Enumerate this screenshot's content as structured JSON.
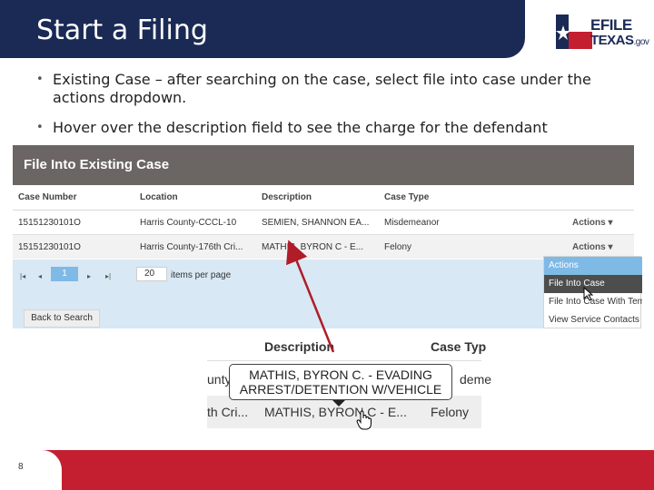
{
  "slide": {
    "title": "Start a Filing",
    "page_number": "8",
    "colors": {
      "header": "#1a2a55",
      "footer": "#c41f30",
      "arrow": "#b01c28"
    }
  },
  "logo": {
    "line1": "EFILE",
    "line2": "TEXAS",
    "suffix": ".gov",
    "icon": "texas-star-icon"
  },
  "bullets": [
    "Existing Case – after searching on the case, select file into case under the actions dropdown.",
    "Hover over the description field to see the charge for the defendant"
  ],
  "panel": {
    "title": "File Into Existing Case",
    "columns": [
      "Case Number",
      "Location",
      "Description",
      "Case Type"
    ],
    "rows": [
      {
        "case_number": "15151230101O",
        "location": "Harris County-CCCL-10",
        "description": "SEMIEN, SHANNON EA...",
        "case_type": "Misdemeanor",
        "actions": "Actions ▾"
      },
      {
        "case_number": "15151230101O",
        "location": "Harris County-176th Cri...",
        "description": "MATHIS, BYRON C - E...",
        "case_type": "Felony",
        "actions": "Actions ▾"
      }
    ],
    "pager": {
      "first": "|◂",
      "prev": "◂",
      "current": "1",
      "next": "▸",
      "last": "▸|",
      "per_page": "20",
      "per_page_label": "items per page"
    },
    "back_button": "Back to Search",
    "menu": [
      "Actions",
      "File Into Case",
      "File Into Case With Tem",
      "View Service Contacts"
    ]
  },
  "zoom": {
    "col_desc": "Description",
    "col_type": "Case Typ",
    "row1_left": "unty.",
    "row1_right": "deme",
    "row2_left": "th Cri...",
    "row2_desc": "MATHIS, BYRON C - E...",
    "row2_type": "Felony",
    "tooltip_line1": "MATHIS, BYRON C. - EVADING",
    "tooltip_line2": "ARREST/DETENTION W/VEHICLE"
  }
}
